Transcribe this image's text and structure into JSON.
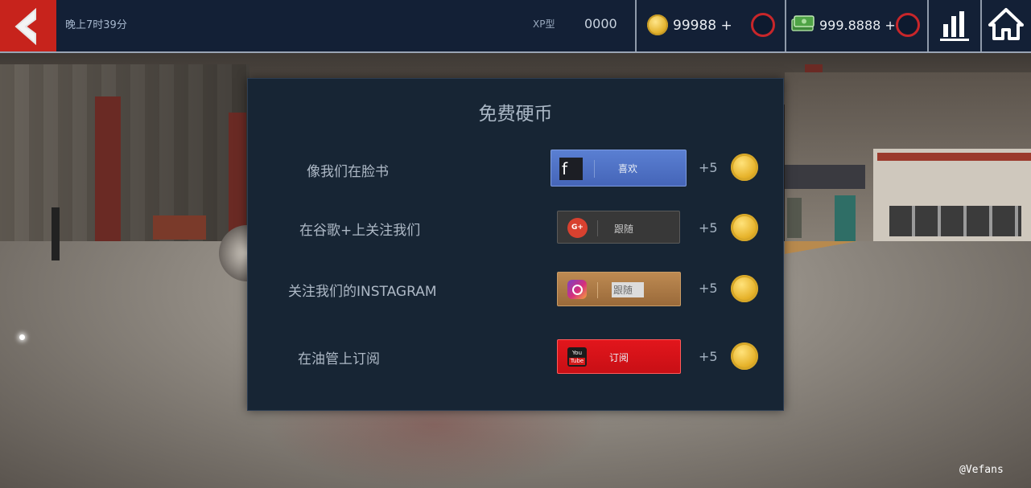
{
  "header": {
    "time": "晚上7时39分",
    "xp_label": "XP型",
    "xp_value": "0000",
    "coins": "99988 +",
    "cash": "999.8888 +"
  },
  "modal": {
    "title": "免费硬币",
    "rows": [
      {
        "label": "像我们在脸书",
        "button": "喜欢",
        "icon": "facebook-icon",
        "reward": "+5"
      },
      {
        "label": "在谷歌+上关注我们",
        "button": "跟随",
        "icon": "google-plus-icon",
        "reward": "+5"
      },
      {
        "label": "关注我们的INSTAGRAM",
        "button": "跟随",
        "icon": "instagram-icon",
        "reward": "+5"
      },
      {
        "label": "在油管上订阅",
        "button": "订阅",
        "icon": "youtube-icon",
        "reward": "+5"
      }
    ]
  },
  "icons": {
    "facebook": "f",
    "google_plus": "G+",
    "youtube_top": "You",
    "youtube_bottom": "Tube"
  },
  "watermark": "@Vefans",
  "colors": {
    "back_button": "#c7231c",
    "topbar": "#132036",
    "facebook_button": "#4a6cc0",
    "google_button": "#3a3a3a",
    "instagram_button": "#b07a44",
    "youtube_button": "#d8141a",
    "coin": "#e6b22a"
  }
}
